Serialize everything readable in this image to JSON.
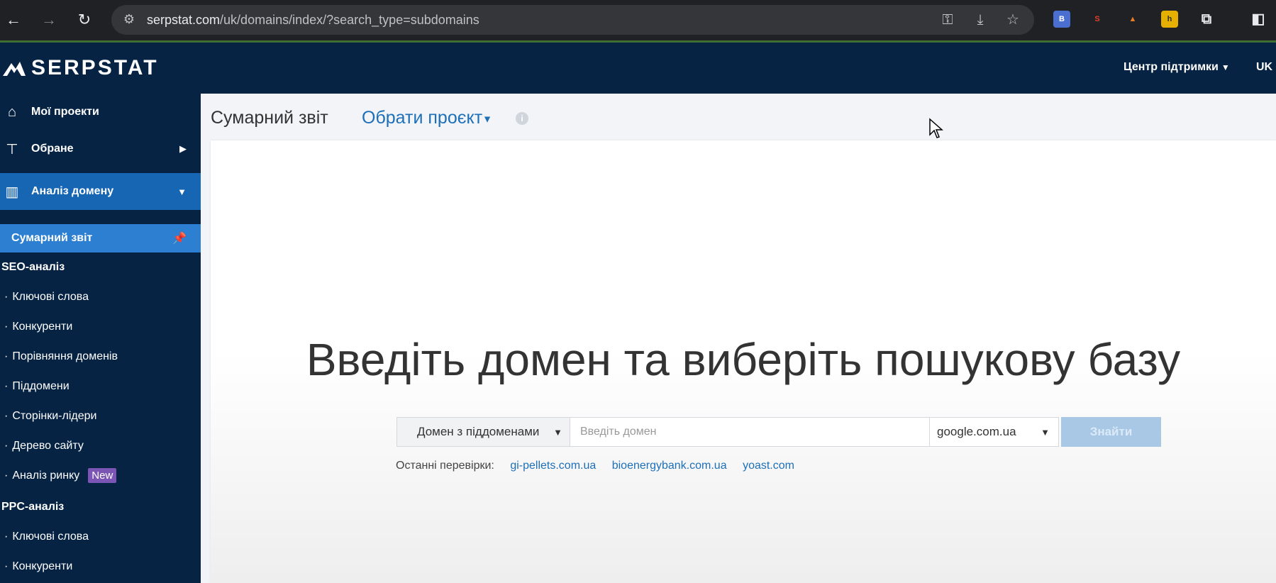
{
  "browser": {
    "url_host": "serpstat.com",
    "url_path": "/uk/domains/index/?search_type=subdomains",
    "icons": [
      "back-icon",
      "forward-icon",
      "reload-icon",
      "site-info-icon",
      "key-icon",
      "install-icon",
      "star-icon",
      "extensions-icon",
      "side-panel-icon"
    ],
    "extensions": [
      {
        "name": "ext-b",
        "label": "B",
        "color": "#4a6fd0"
      },
      {
        "name": "ext-seo",
        "label": "SEO",
        "color": "#c0392b"
      },
      {
        "name": "ext-fox",
        "label": "▲",
        "color": "#e67e22"
      },
      {
        "name": "ext-folder",
        "label": "h",
        "color": "#e5b000"
      }
    ]
  },
  "header": {
    "logo_text": "SERPSTAT",
    "support_label": "Центр підтримки",
    "lang_label": "UK"
  },
  "sidebar": {
    "my_projects": "Мої проекти",
    "favorites": "Обране",
    "domain_analysis": "Аналіз домену",
    "summary_report": "Сумарний звіт",
    "seo_section": "SEO-аналіз",
    "seo_items": [
      "Ключові слова",
      "Конкуренти",
      "Порівняння доменів",
      "Піддомени",
      "Сторінки-лідери",
      "Дерево сайту",
      "Аналіз ринку"
    ],
    "new_badge": "New",
    "ppc_section": "PPC-аналіз",
    "ppc_items": [
      "Ключові слова",
      "Конкуренти"
    ]
  },
  "main": {
    "title": "Сумарний звіт",
    "project_select": "Обрати проєкт",
    "headline": "Введіть домен та виберіть пошукову базу",
    "search": {
      "type_label": "Домен з піддоменами",
      "placeholder": "Введіть домен",
      "value": "",
      "db_label": "google.com.ua",
      "find_label": "Знайти"
    },
    "recent_label": "Останні перевірки:",
    "recent_links": [
      "gi-pellets.com.ua",
      "bioenergybank.com.ua",
      "yoast.com"
    ]
  },
  "colors": {
    "header_bg": "#062344",
    "active_item": "#1666b4",
    "sub_active_item": "#2d7fd1",
    "link": "#1d6fb8",
    "badge": "#7a55b4",
    "find_button": "#a8c8e6"
  }
}
